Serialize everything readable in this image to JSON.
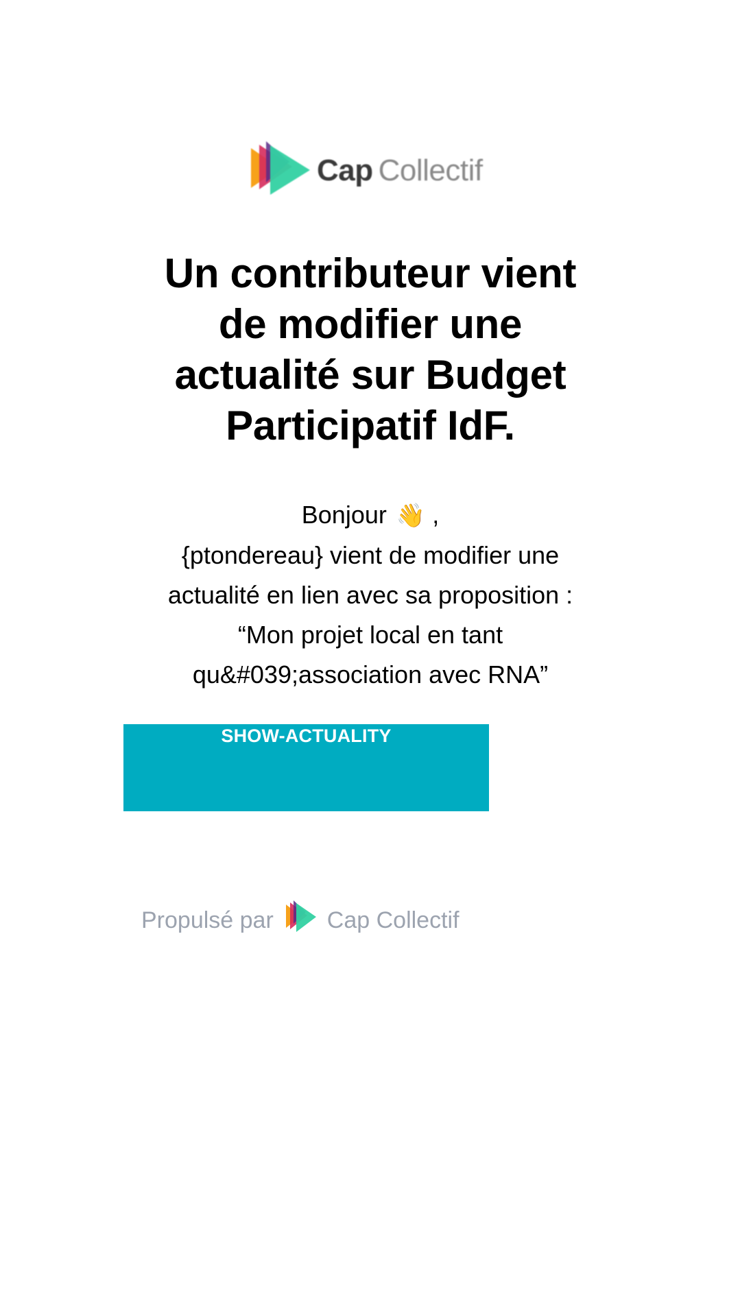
{
  "header": {
    "logo_icon": "cap-collectif-play-logo",
    "logo_word_bold": "Cap",
    "logo_word_light": "Collectif"
  },
  "title": {
    "line1": "Un contributeur vient",
    "line2": "de modifier une",
    "line3": "actualité sur Budget",
    "line4": "Participatif IdF."
  },
  "message": {
    "greeting": "Bonjour",
    "greeting_emoji": "👋",
    "greeting_suffix": " ,",
    "line2": "{ptondereau} vient de modifier une",
    "line3": "actualité en lien avec sa proposition :",
    "line4": "“Mon projet local en tant",
    "line5": "qu&#039;association avec RNA”"
  },
  "cta": {
    "label": "SHOW-ACTUALITY",
    "background_color": "#00acc1",
    "text_color": "#ffffff"
  },
  "footer": {
    "powered_by": "Propulsé par",
    "logo_icon": "cap-collectif-play-logo",
    "brand": "Cap Collectif",
    "text_color": "#9ca3af"
  }
}
